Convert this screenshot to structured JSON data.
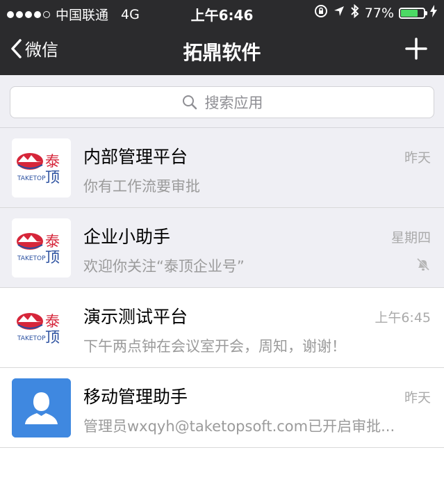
{
  "status_bar": {
    "carrier": "中国联通",
    "network": "4G",
    "time": "上午6:46",
    "battery": "77%",
    "battery_level": 0.77,
    "signal_bars": 4,
    "signal_total": 5
  },
  "nav": {
    "back_label": "微信",
    "title": "拓鼎软件",
    "action_icon": "plus-icon"
  },
  "search": {
    "placeholder": "搜索应用"
  },
  "chats": [
    {
      "name": "内部管理平台",
      "time": "昨天",
      "preview": "你有工作流要审批",
      "avatar": "taketop-logo",
      "muted": false
    },
    {
      "name": "企业小助手",
      "time": "星期四",
      "preview": "欢迎你关注“泰顶企业号”",
      "avatar": "taketop-logo",
      "muted": true
    },
    {
      "name": "演示测试平台",
      "time": "上午6:45",
      "preview": "下午两点钟在会议室开会，周知，谢谢！",
      "avatar": "taketop-logo",
      "muted": false
    },
    {
      "name": "移动管理助手",
      "time": "昨天",
      "preview": "管理员wxqyh@taketopsoft.com已开启审批...",
      "avatar": "default-user",
      "muted": false
    }
  ],
  "logo": {
    "cn": "泰顶",
    "en": "TAKETOP"
  },
  "colors": {
    "bar_bg": "#2b2b2d",
    "battery_green": "#4cd964",
    "list_gray": "#efeff4",
    "avatar_blue": "#3f88e0",
    "logo_red": "#d6263a",
    "logo_blue": "#2a4fa0"
  }
}
